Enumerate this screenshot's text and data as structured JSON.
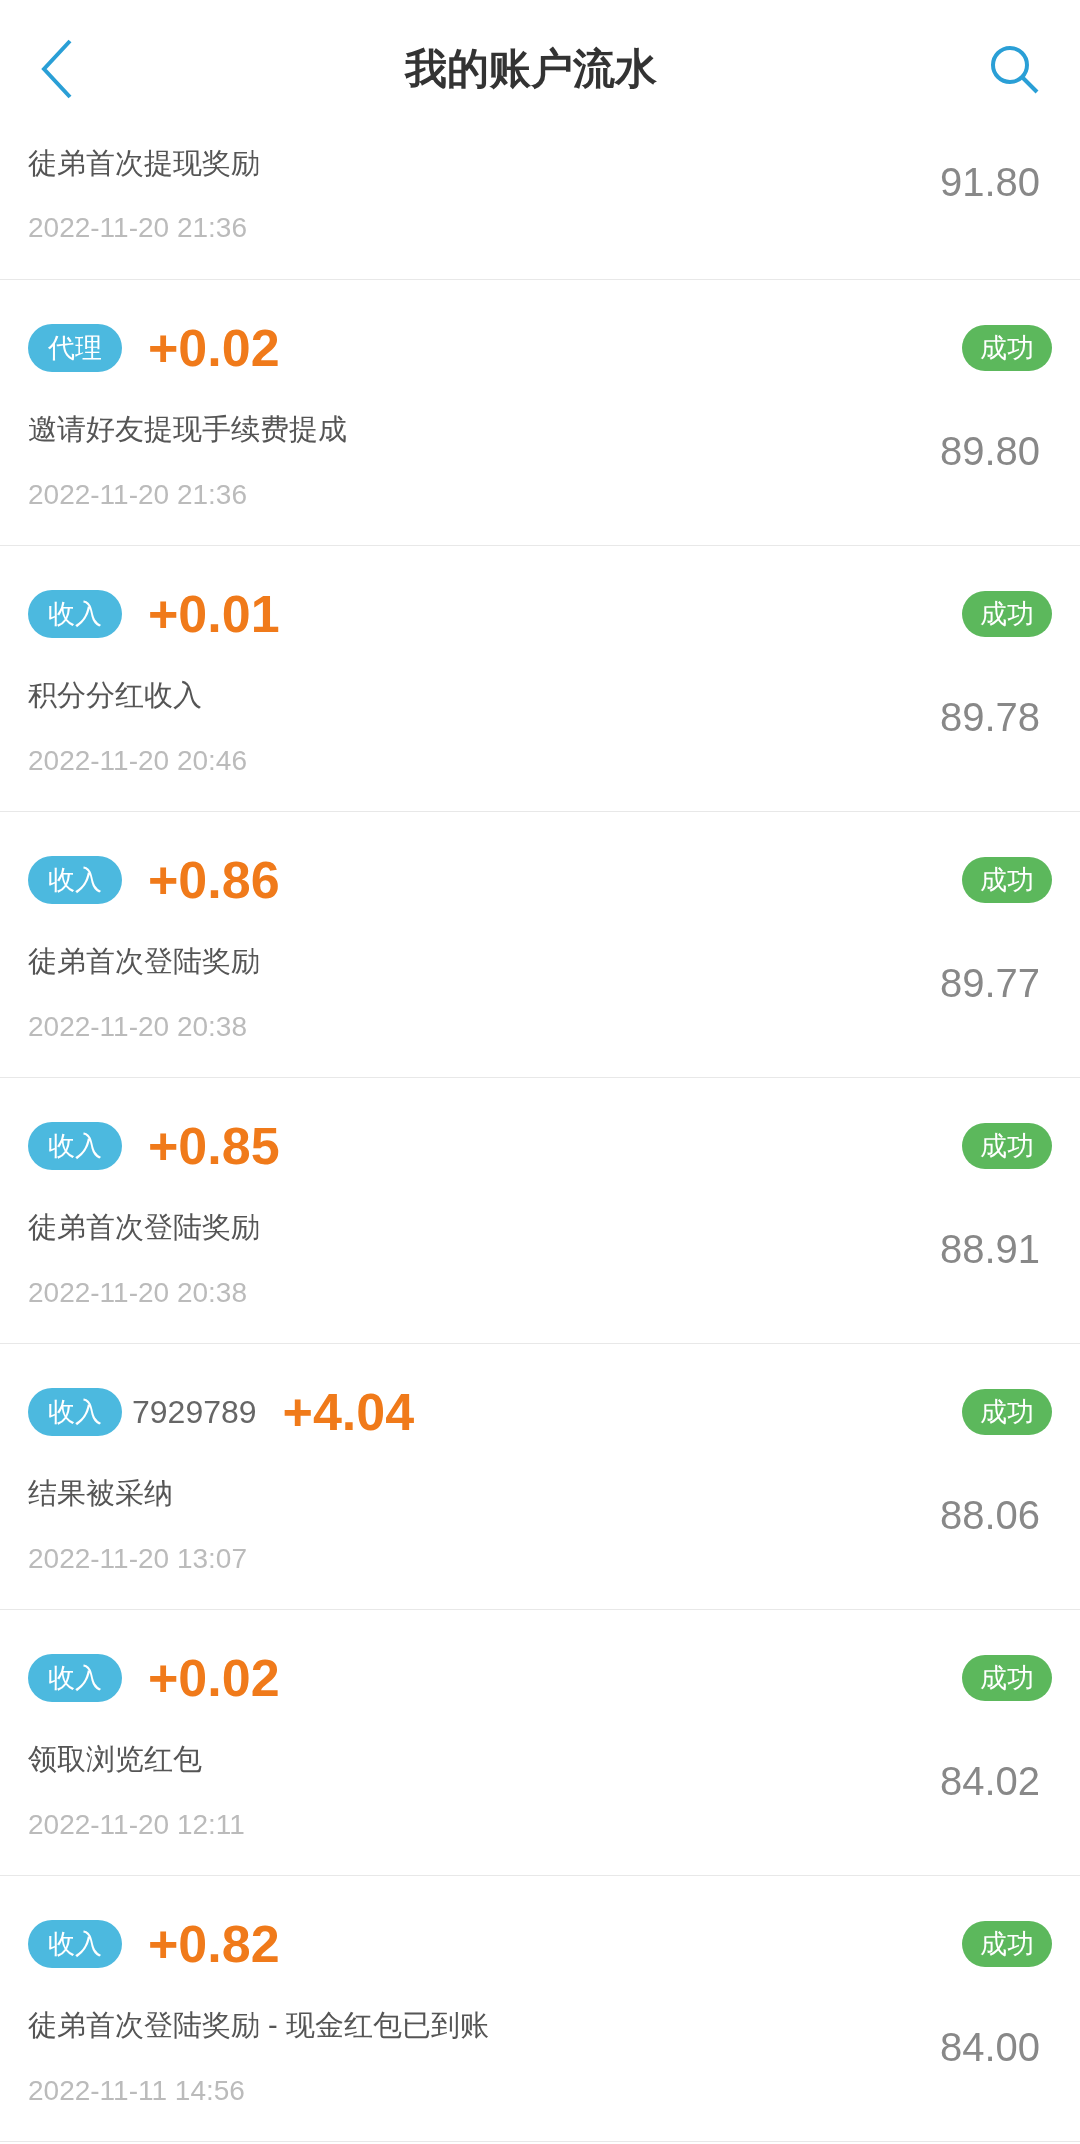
{
  "header": {
    "title": "我的账户流水"
  },
  "partial_entry": {
    "description": "徒弟首次提现奖励",
    "date": "2022-11-20 21:36",
    "balance": "91.80"
  },
  "entries": [
    {
      "tag": "代理",
      "amount": "+0.02",
      "status": "成功",
      "description": "邀请好友提现手续费提成",
      "date": "2022-11-20 21:36",
      "balance": "89.80"
    },
    {
      "tag": "收入",
      "amount": "+0.01",
      "status": "成功",
      "description": "积分分红收入",
      "date": "2022-11-20 20:46",
      "balance": "89.78"
    },
    {
      "tag": "收入",
      "amount": "+0.86",
      "status": "成功",
      "description": "徒弟首次登陆奖励",
      "date": "2022-11-20 20:38",
      "balance": "89.77"
    },
    {
      "tag": "收入",
      "amount": "+0.85",
      "status": "成功",
      "description": "徒弟首次登陆奖励",
      "date": "2022-11-20 20:38",
      "balance": "88.91"
    },
    {
      "tag": "收入",
      "reference": "7929789",
      "amount": "+4.04",
      "status": "成功",
      "description": "结果被采纳",
      "date": "2022-11-20 13:07",
      "balance": "88.06"
    },
    {
      "tag": "收入",
      "amount": "+0.02",
      "status": "成功",
      "description": "领取浏览红包",
      "date": "2022-11-20 12:11",
      "balance": "84.02"
    },
    {
      "tag": "收入",
      "amount": "+0.82",
      "status": "成功",
      "description": "徒弟首次登陆奖励 - 现金红包已到账",
      "date": "2022-11-11 14:56",
      "balance": "84.00"
    }
  ]
}
